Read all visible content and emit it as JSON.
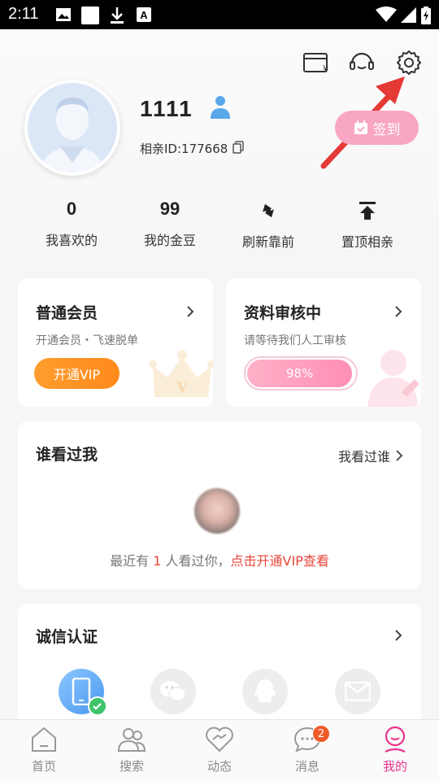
{
  "status_bar": {
    "time": "2:11"
  },
  "profile": {
    "username": "1111",
    "id_text": "相亲ID:177668",
    "checkin_label": "签到"
  },
  "stats": [
    {
      "value": "0",
      "label": "我喜欢的"
    },
    {
      "value": "99",
      "label": "我的金豆"
    },
    {
      "value": "",
      "label": "刷新靠前",
      "icon": "refresh-icon"
    },
    {
      "value": "",
      "label": "置顶相亲",
      "icon": "pin-top-icon"
    }
  ],
  "membership_card": {
    "title": "普通会员",
    "subtitle": "开通会员・飞速脱单",
    "button": "开通VIP"
  },
  "review_card": {
    "title": "资料审核中",
    "subtitle": "请等待我们人工审核",
    "progress_text": "98%",
    "progress": 0.98
  },
  "viewers": {
    "title": "谁看过我",
    "link": "我看过谁",
    "text_prefix": "最近有",
    "count": "1",
    "text_middle": "人看过你，",
    "cta": "点击开通VIP查看"
  },
  "verification": {
    "title": "诚信认证",
    "items": [
      "phone-icon",
      "wechat-icon",
      "qq-icon",
      "mail-icon"
    ]
  },
  "bottom_nav": [
    {
      "label": "首页"
    },
    {
      "label": "搜索"
    },
    {
      "label": "动态"
    },
    {
      "label": "消息",
      "badge": "2"
    },
    {
      "label": "我的"
    }
  ],
  "colors": {
    "accent_pink": "#e8338a",
    "checkin_pink": "#f9a6c2",
    "vip_orange": "#ff8a1a",
    "alert_red": "#e8463a"
  }
}
